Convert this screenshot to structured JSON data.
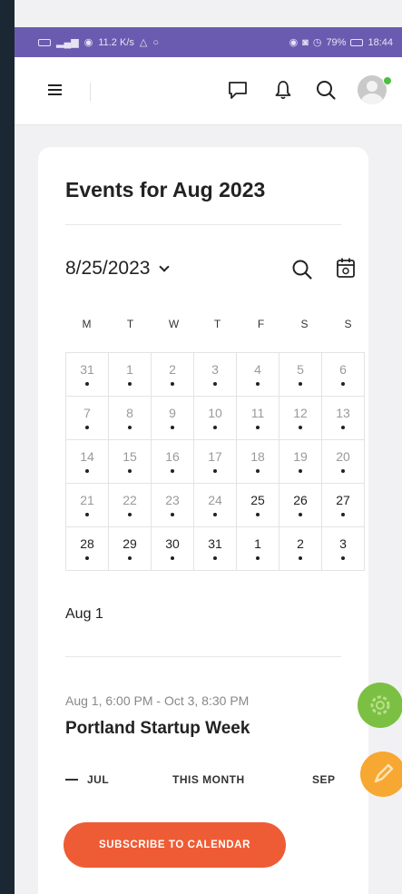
{
  "statusbar": {
    "left_text": "11.2 K/s",
    "battery": "79%",
    "time": "18:44"
  },
  "topbar": {
    "icons": [
      "menu-icon",
      "chat-icon",
      "bell-icon",
      "search-icon",
      "avatar"
    ]
  },
  "card": {
    "title": "Events for Aug 2023",
    "date_selector": "8/25/2023",
    "weekdays": [
      "M",
      "T",
      "W",
      "T",
      "F",
      "S",
      "S"
    ],
    "weeks": [
      [
        {
          "d": "31",
          "cur": false
        },
        {
          "d": "1",
          "cur": false
        },
        {
          "d": "2",
          "cur": false
        },
        {
          "d": "3",
          "cur": false
        },
        {
          "d": "4",
          "cur": false
        },
        {
          "d": "5",
          "cur": false
        },
        {
          "d": "6",
          "cur": false
        }
      ],
      [
        {
          "d": "7",
          "cur": false
        },
        {
          "d": "8",
          "cur": false
        },
        {
          "d": "9",
          "cur": false
        },
        {
          "d": "10",
          "cur": false
        },
        {
          "d": "11",
          "cur": false
        },
        {
          "d": "12",
          "cur": false
        },
        {
          "d": "13",
          "cur": false
        }
      ],
      [
        {
          "d": "14",
          "cur": false
        },
        {
          "d": "15",
          "cur": false
        },
        {
          "d": "16",
          "cur": false
        },
        {
          "d": "17",
          "cur": false
        },
        {
          "d": "18",
          "cur": false
        },
        {
          "d": "19",
          "cur": false
        },
        {
          "d": "20",
          "cur": false
        }
      ],
      [
        {
          "d": "21",
          "cur": false
        },
        {
          "d": "22",
          "cur": false
        },
        {
          "d": "23",
          "cur": false
        },
        {
          "d": "24",
          "cur": false
        },
        {
          "d": "25",
          "cur": true
        },
        {
          "d": "26",
          "cur": true
        },
        {
          "d": "27",
          "cur": true
        }
      ],
      [
        {
          "d": "28",
          "cur": true
        },
        {
          "d": "29",
          "cur": true
        },
        {
          "d": "30",
          "cur": true
        },
        {
          "d": "31",
          "cur": true
        },
        {
          "d": "1",
          "cur": true
        },
        {
          "d": "2",
          "cur": true
        },
        {
          "d": "3",
          "cur": true
        }
      ]
    ],
    "day_label": "Aug 1",
    "event": {
      "time": "Aug 1, 6:00 PM - Oct 3, 8:30 PM",
      "title": "Portland Startup Week"
    },
    "nav": {
      "prev": "JUL",
      "this": "THIS MONTH",
      "next": "SEP"
    },
    "subscribe_label": "SUBSCRIBE TO CALENDAR"
  },
  "colors": {
    "statusbar": "#6b5bb0",
    "accent": "#ee5c35",
    "fab_green": "#7bc042",
    "fab_orange": "#f7a832",
    "online": "#4cbf3f"
  }
}
